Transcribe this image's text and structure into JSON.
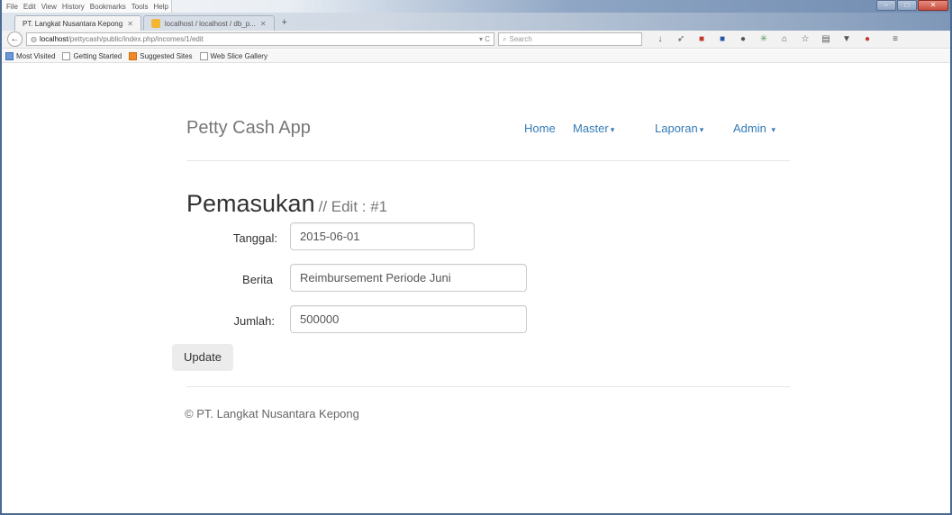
{
  "browser": {
    "menu": [
      "File",
      "Edit",
      "View",
      "History",
      "Bookmarks",
      "Tools",
      "Help"
    ],
    "tabs": [
      {
        "title": "PT. Langkat Nusantara Kepong",
        "active": true
      },
      {
        "title": "localhost / localhost / db_p...",
        "active": false
      }
    ],
    "new_tab_label": "+",
    "url_host": "localhost",
    "url_path": "/pettycash/public/index.php/incomes/1/edit",
    "search_placeholder": "Search",
    "bookmarks": [
      "Most Visited",
      "Getting Started",
      "Suggested Sites",
      "Web Slice Gallery"
    ]
  },
  "app": {
    "brand": "Petty Cash App",
    "nav": {
      "home": "Home",
      "master": "Master",
      "laporan": "Laporan",
      "admin": "Admin"
    },
    "caret": "▾"
  },
  "form": {
    "title": "Pemasukan",
    "subtitle": "// Edit : #1",
    "tanggal_label": "Tanggal:",
    "tanggal_value": "2015-06-01",
    "berita_label": "Berita",
    "berita_value": "Reimbursement Periode Juni",
    "jumlah_label": "Jumlah:",
    "jumlah_value": "500000",
    "update_label": "Update"
  },
  "footer": {
    "copyright": "© PT. Langkat Nusantara Kepong"
  },
  "colors": {
    "link": "#337ab7",
    "brand": "#777777",
    "button_bg": "#ececec"
  }
}
